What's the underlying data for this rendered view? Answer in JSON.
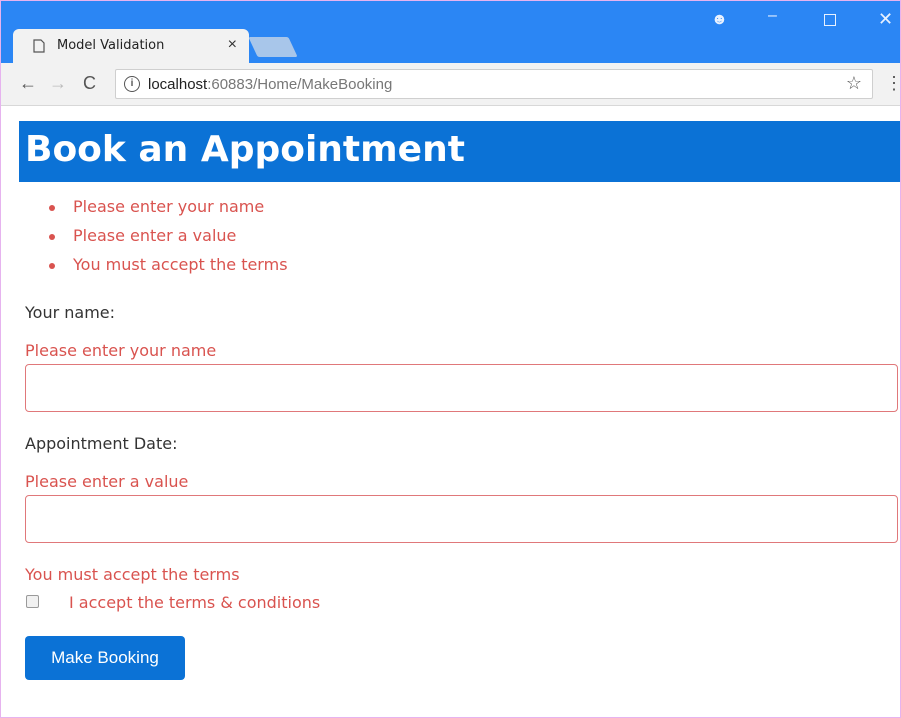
{
  "browser": {
    "tab_title": "Model Validation",
    "tab_close": "×",
    "url_host": "localhost",
    "url_rest": ":60883/Home/MakeBooking",
    "icons": {
      "back": "←",
      "forward": "→",
      "reload": "C",
      "info": "i",
      "star": "☆",
      "menu": "⋮",
      "account": "☻",
      "minimize": "–",
      "close": "✕"
    }
  },
  "page": {
    "heading": "Book an Appointment",
    "summary_errors": [
      "Please enter your name",
      "Please enter a value",
      "You must accept the terms"
    ],
    "name_label": "Your name:",
    "name_error": "Please enter your name",
    "name_value": "",
    "date_label": "Appointment Date:",
    "date_error": "Please enter a value",
    "date_value": "",
    "terms_error": "You must accept the terms",
    "terms_label": "I accept the terms & conditions",
    "terms_checked": false,
    "submit_label": "Make Booking"
  },
  "colors": {
    "titlebar": "#2b86f4",
    "header": "#0b72d6",
    "error": "#d9534f"
  }
}
